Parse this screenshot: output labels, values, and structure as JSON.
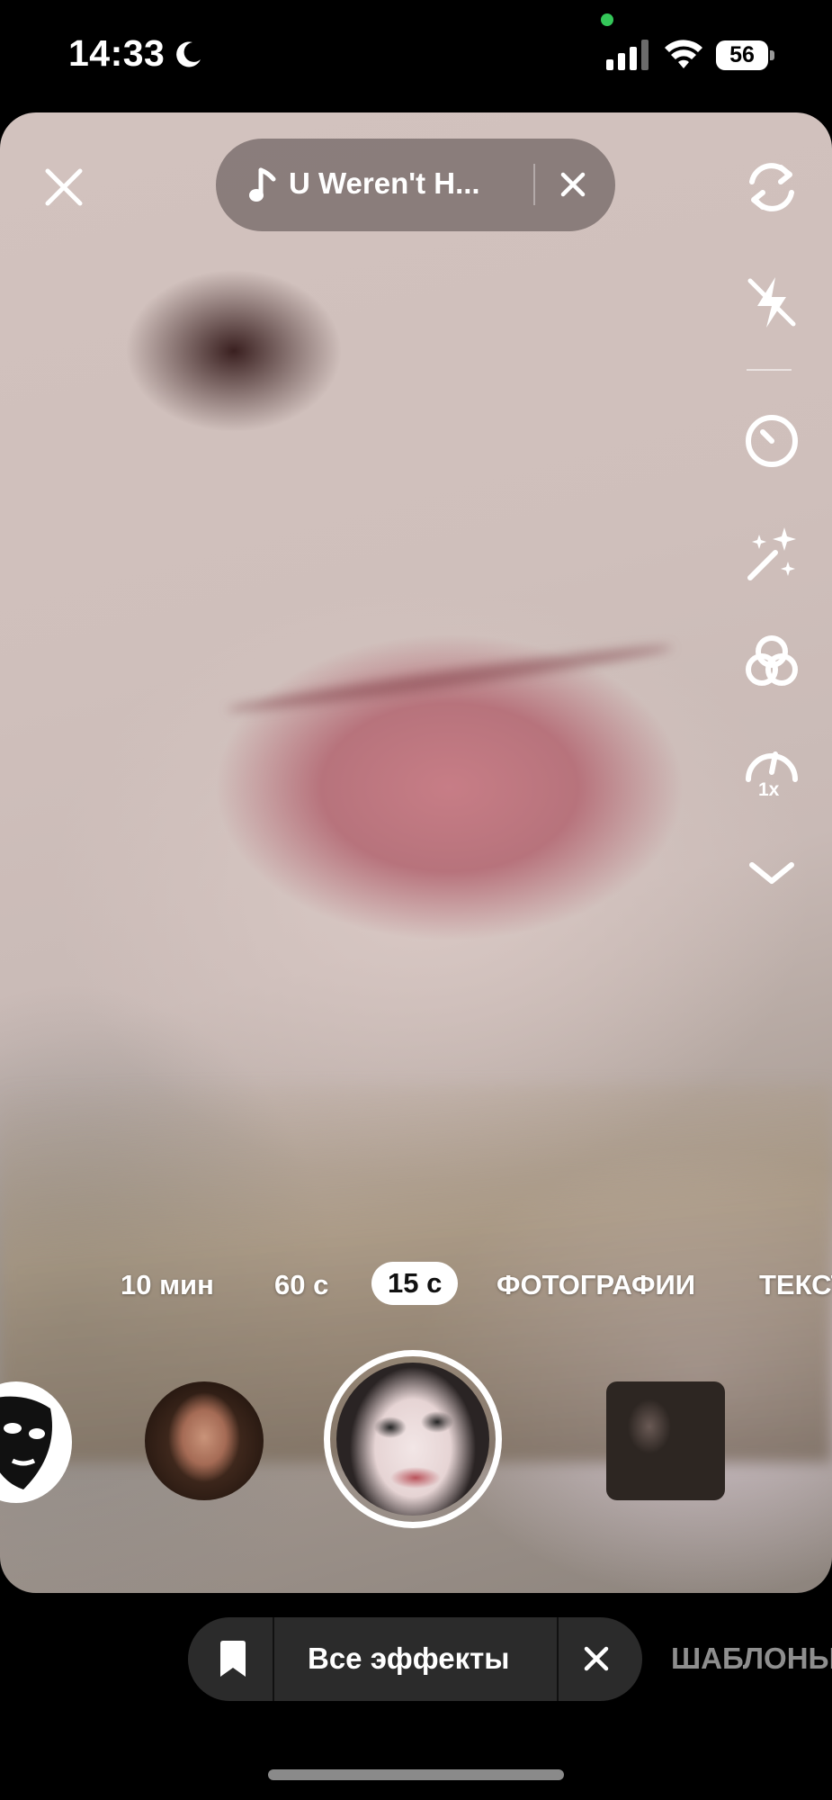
{
  "status_bar": {
    "time": "14:33",
    "battery": "56",
    "icons": [
      "moon-icon",
      "camera-in-use-indicator",
      "cellular-signal-icon",
      "wifi-icon",
      "battery-icon"
    ]
  },
  "music": {
    "title": "U Weren't H...",
    "note_icon": "music-note-icon",
    "clear_icon": "close-icon"
  },
  "top_controls": {
    "close_icon": "close-icon"
  },
  "right_rail": [
    {
      "icon": "flip-camera-icon"
    },
    {
      "icon": "flash-off-icon"
    },
    {
      "icon": "timer-icon"
    },
    {
      "icon": "enhance-sparkle-icon"
    },
    {
      "icon": "filters-icon"
    },
    {
      "icon": "speed-icon",
      "label": "1x"
    },
    {
      "icon": "chevron-down-icon"
    }
  ],
  "modes": [
    "10 мин",
    "60 с",
    "15 с",
    "ФОТОГРАФИИ",
    "ТЕКСТ"
  ],
  "selected_mode": "15 с",
  "effects": [
    "mask-effect",
    "portrait-effect",
    "selected-face-effect",
    "photo-effect"
  ],
  "bottom_bar": {
    "bookmark_icon": "bookmark-icon",
    "all_effects": "Все эффекты",
    "clear_icon": "close-icon",
    "templates": "ШАБЛОНЫ"
  },
  "colors": {
    "background": "#000000",
    "pill": "#2b2b2b",
    "inactive_tab": "#8e8e8e",
    "camera_indicator": "#34c759"
  }
}
